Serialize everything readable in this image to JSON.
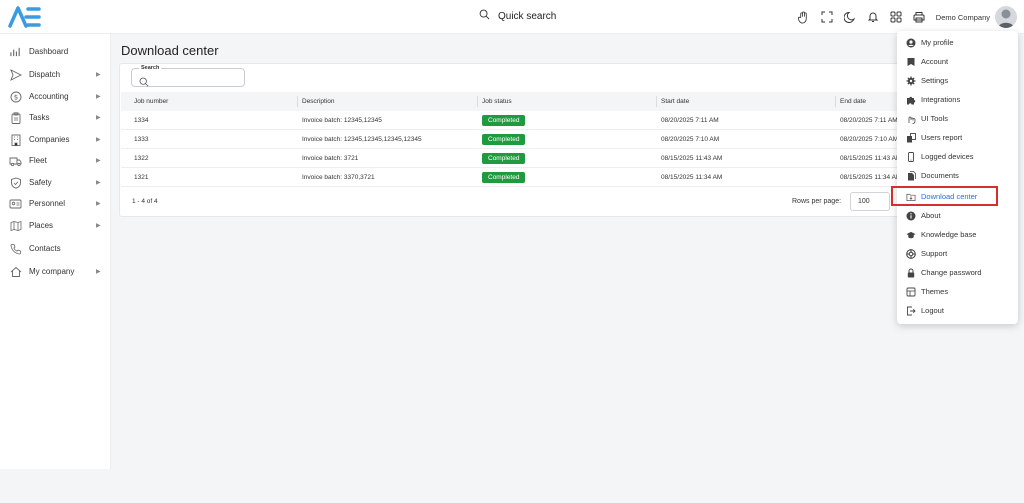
{
  "app": {
    "logo": "AE"
  },
  "header": {
    "quick_search": "Quick search",
    "company": "Demo Company",
    "icons": [
      "hand-icon",
      "fullscreen-icon",
      "moon-icon",
      "bell-icon",
      "apps-grid-icon",
      "printer-icon"
    ]
  },
  "sidebar": {
    "items": [
      {
        "label": "Dashboard",
        "icon": "dashboard-icon",
        "has_submenu": false
      },
      {
        "label": "Dispatch",
        "icon": "dispatch-icon",
        "has_submenu": true
      },
      {
        "label": "Accounting",
        "icon": "dollar-icon",
        "has_submenu": true
      },
      {
        "label": "Tasks",
        "icon": "clipboard-icon",
        "has_submenu": true
      },
      {
        "label": "Companies",
        "icon": "building-icon",
        "has_submenu": true
      },
      {
        "label": "Fleet",
        "icon": "truck-icon",
        "has_submenu": true
      },
      {
        "label": "Safety",
        "icon": "shield-icon",
        "has_submenu": true
      },
      {
        "label": "Personnel",
        "icon": "id-card-icon",
        "has_submenu": true
      },
      {
        "label": "Places",
        "icon": "map-icon",
        "has_submenu": true
      },
      {
        "label": "Contacts",
        "icon": "phone-icon",
        "has_submenu": false
      },
      {
        "label": "My company",
        "icon": "home-icon",
        "has_submenu": true
      }
    ],
    "arrow": "▶"
  },
  "main": {
    "title": "Download center",
    "search": {
      "label": "Search",
      "value": ""
    },
    "columns": [
      "Job number",
      "Description",
      "Job status",
      "Start date",
      "End date"
    ],
    "rows": [
      {
        "job": "1334",
        "desc": "Invoice batch: 12345,12345",
        "status": "Completed",
        "start": "08/20/2025 7:11 AM",
        "end": "08/20/2025 7:11 AM"
      },
      {
        "job": "1333",
        "desc": "Invoice batch: 12345,12345,12345,12345",
        "status": "Completed",
        "start": "08/20/2025 7:10 AM",
        "end": "08/20/2025 7:10 AM"
      },
      {
        "job": "1322",
        "desc": "Invoice batch: 3721",
        "status": "Completed",
        "start": "08/15/2025 11:43 AM",
        "end": "08/15/2025 11:43 AM"
      },
      {
        "job": "1321",
        "desc": "Invoice batch: 3370,3721",
        "status": "Completed",
        "start": "08/15/2025 11:34 AM",
        "end": "08/15/2025 11:34 AM"
      }
    ],
    "pagination": {
      "range": "1 - 4 of 4",
      "rows_per_page_label": "Rows per page:",
      "rows_per_page": "100"
    }
  },
  "user_menu": {
    "items": [
      {
        "label": "My profile",
        "icon": "user-circle-icon"
      },
      {
        "label": "Account",
        "icon": "account-icon"
      },
      {
        "label": "Settings",
        "icon": "gear-icon"
      },
      {
        "label": "Integrations",
        "icon": "puzzle-icon"
      },
      {
        "label": "UI Tools",
        "icon": "ui-tools-icon"
      },
      {
        "label": "Users report",
        "icon": "users-report-icon"
      },
      {
        "label": "Logged devices",
        "icon": "phone-device-icon"
      },
      {
        "label": "Documents",
        "icon": "documents-icon"
      },
      {
        "label": "Download center",
        "icon": "download-folder-icon",
        "active": true
      },
      {
        "label": "About",
        "icon": "info-icon"
      },
      {
        "label": "Knowledge base",
        "icon": "graduation-cap-icon"
      },
      {
        "label": "Support",
        "icon": "support-icon"
      },
      {
        "label": "Change password",
        "icon": "lock-icon"
      },
      {
        "label": "Themes",
        "icon": "themes-icon"
      },
      {
        "label": "Logout",
        "icon": "logout-icon"
      }
    ]
  },
  "colors": {
    "accent": "#2a6fd0",
    "status_completed": "#1f9a3e",
    "highlight": "#d32f2f"
  }
}
